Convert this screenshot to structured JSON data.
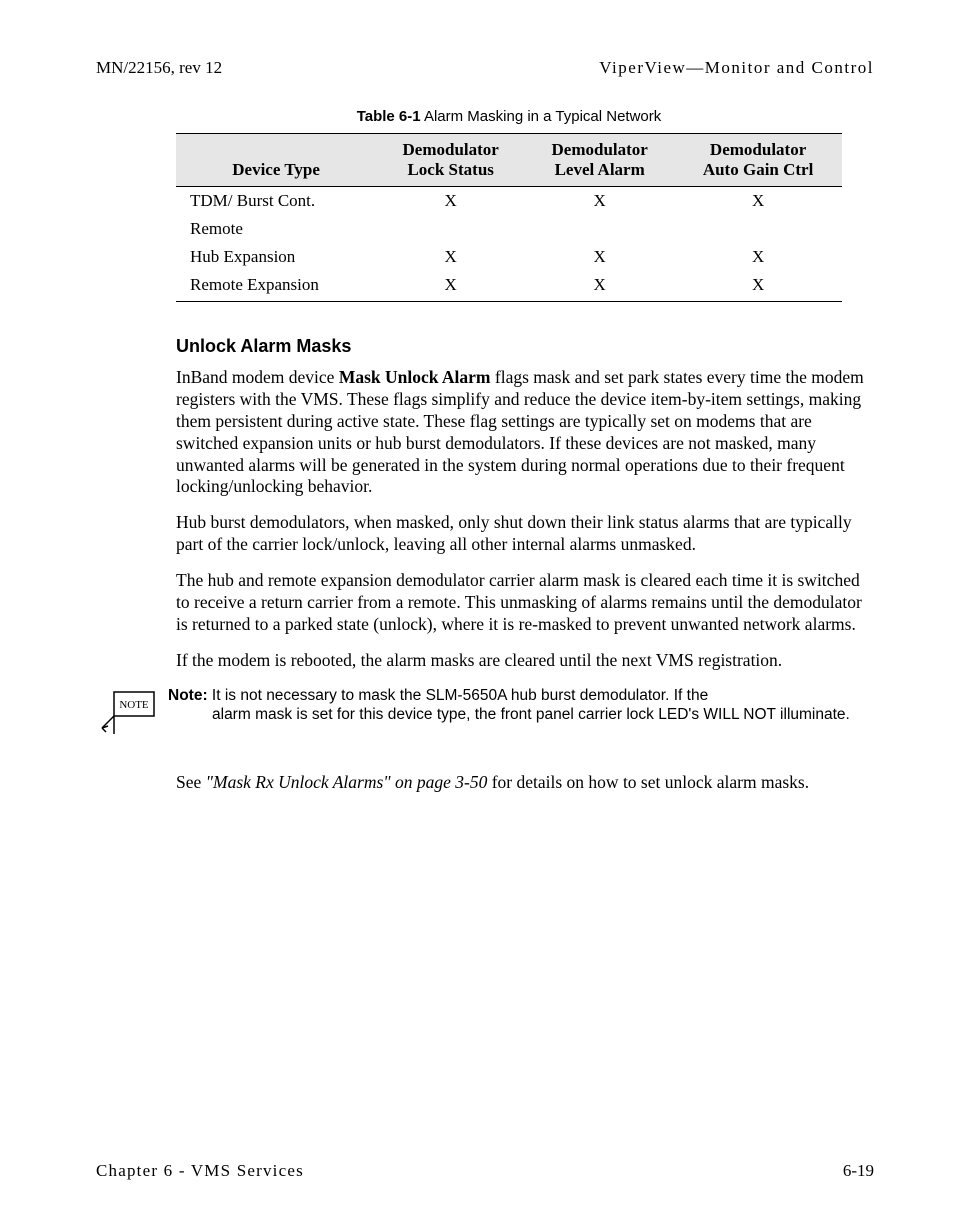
{
  "header": {
    "left": "MN/22156, rev 12",
    "right": "ViperView—Monitor and Control"
  },
  "table": {
    "caption_label": "Table 6-1",
    "caption_text": "  Alarm Masking in a Typical Network",
    "headers": {
      "c0": "Device Type",
      "c1_l1": "Demodulator",
      "c1_l2": "Lock Status",
      "c2_l1": "Demodulator",
      "c2_l2": "Level Alarm",
      "c3_l1": "Demodulator",
      "c3_l2": "Auto Gain Ctrl"
    },
    "rows": [
      {
        "c0": "TDM/ Burst Cont.",
        "c1": "X",
        "c2": "X",
        "c3": "X"
      },
      {
        "c0": "Remote",
        "c1": "",
        "c2": "",
        "c3": ""
      },
      {
        "c0": "Hub Expansion",
        "c1": "X",
        "c2": "X",
        "c3": "X"
      },
      {
        "c0": "Remote Expansion",
        "c1": "X",
        "c2": "X",
        "c3": "X"
      }
    ]
  },
  "section": {
    "heading": "Unlock Alarm Masks",
    "p1_a": "InBand modem device ",
    "p1_bold": "Mask Unlock Alarm",
    "p1_b": " flags mask and set park states every time the modem registers with the VMS. These flags simplify and reduce the device item-by-item settings, making them persistent during active state. These flag settings are typically set on modems that are switched expansion units or hub burst demodulators. If these devices are not masked, many unwanted alarms will be generated in the system during normal operations due to their frequent locking/unlocking behavior.",
    "p2": "Hub burst demodulators, when masked, only shut down their link status alarms that are typically part of the carrier lock/unlock, leaving all other internal alarms unmasked.",
    "p3": "The hub and remote expansion demodulator carrier alarm mask is cleared each time it is switched to receive a return carrier from a remote. This unmasking of alarms remains until the demodulator is returned to a parked state (unlock), where it is re-masked to prevent unwanted network alarms.",
    "p4": "If the modem is rebooted, the alarm masks are cleared until the next VMS registration."
  },
  "note": {
    "label": "Note:",
    "text_first": " It is not necessary to mask the SLM-5650A hub burst demodulator. If the",
    "text_rest": "alarm mask is set for this device type, the front panel carrier lock LED's WILL NOT illuminate.",
    "icon_label": "NOTE"
  },
  "see": {
    "pre": "See ",
    "italic": "\"Mask Rx Unlock Alarms\" on page 3-50",
    "post": " for details on how to set unlock alarm masks."
  },
  "footer": {
    "left": "Chapter 6 - VMS Services",
    "right": "6-19"
  }
}
